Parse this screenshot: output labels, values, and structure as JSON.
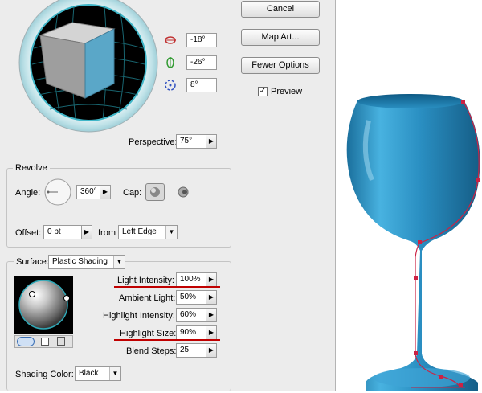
{
  "buttons": {
    "cancel": "Cancel",
    "map_art": "Map Art...",
    "fewer_options": "Fewer Options"
  },
  "preview": {
    "label": "Preview",
    "checked": true,
    "mark": "✓"
  },
  "rotation": {
    "x_value": "-18°",
    "y_value": "-26°",
    "z_value": "8°"
  },
  "perspective": {
    "label": "Perspective:",
    "value": "75°"
  },
  "revolve": {
    "section_label": "Revolve",
    "angle_label": "Angle:",
    "angle_value": "360°",
    "cap_label": "Cap:",
    "offset_label": "Offset:",
    "offset_value": "0 pt",
    "from_label": "from",
    "from_value": "Left Edge"
  },
  "surface": {
    "label": "Surface:",
    "value": "Plastic Shading",
    "light_intensity_label": "Light Intensity:",
    "light_intensity_value": "100%",
    "ambient_light_label": "Ambient Light:",
    "ambient_light_value": "50%",
    "highlight_intensity_label": "Highlight Intensity:",
    "highlight_intensity_value": "60%",
    "highlight_size_label": "Highlight Size:",
    "highlight_size_value": "90%",
    "blend_steps_label": "Blend Steps:",
    "blend_steps_value": "25",
    "shading_color_label": "Shading Color:",
    "shading_color_value": "Black"
  },
  "colors": {
    "cube_front": "#5aa7c8",
    "cube_side": "#9e9e9e",
    "cube_top": "#d4d4d4",
    "glass": "#2a8fc2",
    "path": "#cc2244",
    "highlight_underline": "#c00000"
  },
  "icons": [
    "x-rotation-icon",
    "y-rotation-icon",
    "z-rotation-icon",
    "spinner-arrow-icon",
    "cap-on-icon",
    "cap-off-icon",
    "new-light-icon",
    "move-light-back-icon",
    "delete-light-icon",
    "dropdown-arrow-icon"
  ]
}
